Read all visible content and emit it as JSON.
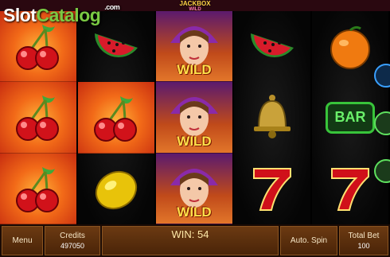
{
  "brand": {
    "slot": "Slot",
    "catalog": "Catalog",
    "com": ".com"
  },
  "game": {
    "logo_line1": "JACKBOX",
    "logo_line2": "WILD"
  },
  "reels": [
    {
      "symbols": [
        "cherry",
        "cherry",
        "cherry"
      ],
      "background": "fire"
    },
    {
      "symbols": [
        "watermelon",
        "cherry",
        "lemon"
      ],
      "background": "mixed"
    },
    {
      "symbols": [
        "wild",
        "wild",
        "wild"
      ],
      "background": "wild"
    },
    {
      "symbols": [
        "watermelon",
        "bell",
        "seven"
      ],
      "background": "dark"
    },
    {
      "symbols": [
        "orange",
        "bar",
        "seven"
      ],
      "background": "dark"
    }
  ],
  "wild_label": "WILD",
  "bar_label": "BAR",
  "controls": {
    "menu_label": "Menu",
    "credits_label": "Credits",
    "credits_value": "497050",
    "win_label": "WIN: 54",
    "auto_spin_label": "Auto. Spin",
    "total_bet_label": "Total Bet",
    "total_bet_value": "100"
  },
  "colors": {
    "accent": "#ffe14a",
    "bottom_bar": "#4a2408",
    "brand_green": "#7ac943"
  }
}
